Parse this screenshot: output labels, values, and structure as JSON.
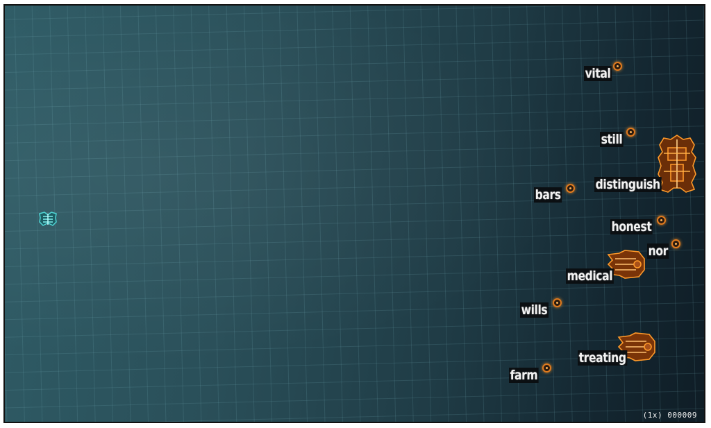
{
  "words": [
    "vital",
    "still",
    "distinguish",
    "bars",
    "honest",
    "nor",
    "medical",
    "wills",
    "treating",
    "farm"
  ],
  "hud": {
    "multiplier": "(1x)",
    "score": "000009"
  },
  "colors": {
    "player": "#4fd6d6",
    "enemy": "#ff9a2a",
    "word_bg": "#0b0f12",
    "word_text": "#f2f2f2"
  }
}
